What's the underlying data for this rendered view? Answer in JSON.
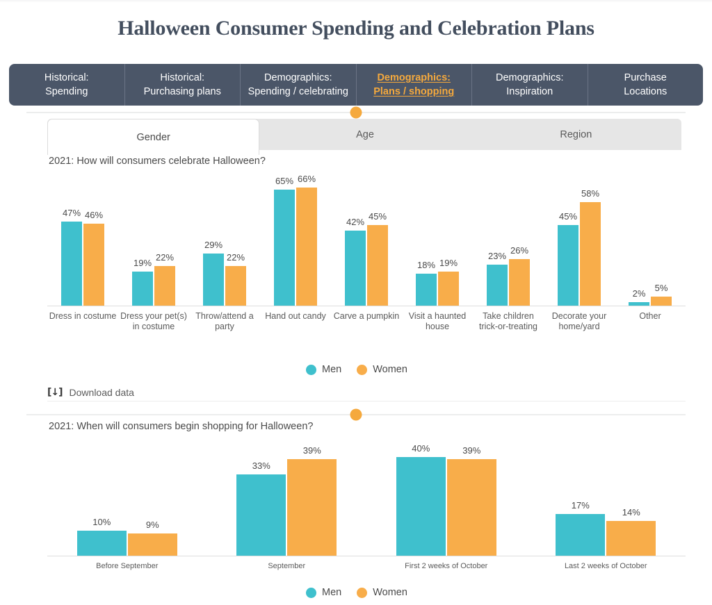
{
  "header": {
    "title": "Halloween Consumer Spending and Celebration Plans"
  },
  "nav": {
    "items": [
      {
        "line1": "Historical:",
        "line2": "Spending",
        "active": false
      },
      {
        "line1": "Historical:",
        "line2": "Purchasing plans",
        "active": false
      },
      {
        "line1": "Demographics:",
        "line2": "Spending / celebrating",
        "active": false
      },
      {
        "line1": "Demographics:",
        "line2": "Plans / shopping",
        "active": true
      },
      {
        "line1": "Demographics:",
        "line2": "Inspiration",
        "active": false
      },
      {
        "line1": "Purchase",
        "line2": "Locations",
        "active": false
      }
    ]
  },
  "subtabs": {
    "items": [
      {
        "label": "Gender",
        "active": true
      },
      {
        "label": "Age",
        "active": false
      },
      {
        "label": "Region",
        "active": false
      }
    ]
  },
  "download": {
    "icon": "download-bracket-icon",
    "label": "Download data"
  },
  "legend": {
    "men": "Men",
    "women": "Women"
  },
  "colors": {
    "men": "#3fc0cd",
    "women": "#f8ad4a",
    "nav_background": "#4b5668",
    "nav_active_text": "#f5a93d",
    "title": "#434e5e",
    "knob": "#f5a93d"
  },
  "chart_data": [
    {
      "type": "bar",
      "title": "2021: How will consumers celebrate Halloween?",
      "xlabel": "",
      "ylabel": "",
      "ylim": [
        0,
        70
      ],
      "grid": false,
      "legend_position": "bottom",
      "value_suffix": "%",
      "categories": [
        "Dress in costume",
        "Dress your pet(s) in costume",
        "Throw/attend a party",
        "Hand out candy",
        "Carve a pumpkin",
        "Visit a haunted house",
        "Take children trick-or-treating",
        "Decorate your home/yard",
        "Other"
      ],
      "series": [
        {
          "name": "Men",
          "values": [
            47,
            19,
            29,
            65,
            42,
            18,
            23,
            45,
            2
          ]
        },
        {
          "name": "Women",
          "values": [
            46,
            22,
            22,
            66,
            45,
            19,
            26,
            58,
            5
          ]
        }
      ]
    },
    {
      "type": "bar",
      "title": "2021: When will consumers begin shopping for Halloween?",
      "xlabel": "",
      "ylabel": "",
      "ylim": [
        0,
        45
      ],
      "grid": false,
      "legend_position": "bottom",
      "value_suffix": "%",
      "categories": [
        "Before September",
        "September",
        "First 2 weeks of October",
        "Last 2 weeks of October"
      ],
      "series": [
        {
          "name": "Men",
          "values": [
            10,
            33,
            40,
            17
          ]
        },
        {
          "name": "Women",
          "values": [
            9,
            39,
            39,
            14
          ]
        }
      ]
    }
  ]
}
